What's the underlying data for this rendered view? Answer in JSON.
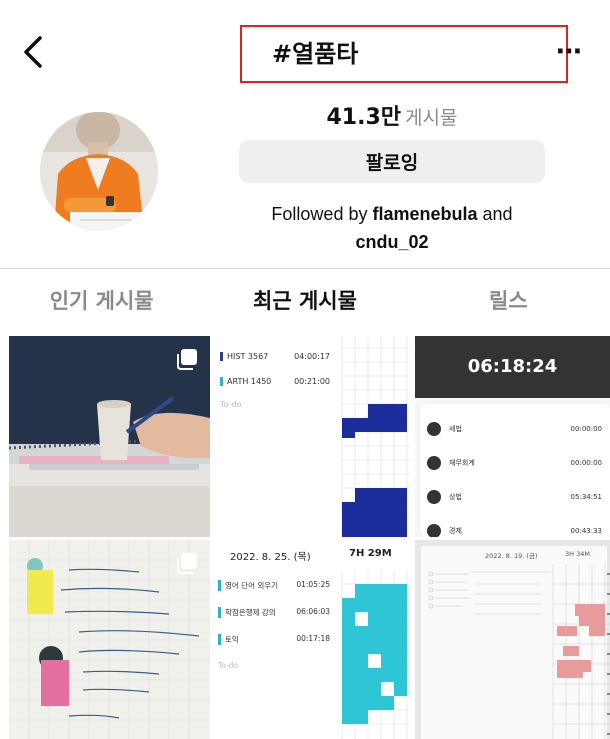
{
  "header": {
    "title": "#열품타"
  },
  "stats": {
    "count": "41.3만",
    "count_label": "게시물"
  },
  "follow_button": "팔로잉",
  "followed_by": {
    "prefix": "Followed by ",
    "user1": "flamenebula",
    "joiner": " and",
    "user2": "cndu_02"
  },
  "tabs": [
    "인기 게시물",
    "최근 게시물",
    "릴스"
  ],
  "posts": {
    "p2": {
      "items": [
        {
          "name": "HIST 3567",
          "time": "04:00:17"
        },
        {
          "name": "ARTH 1450",
          "time": "00:21:00"
        }
      ],
      "todo": "To-do"
    },
    "p3": {
      "timer": "06:18:24",
      "items": [
        {
          "name": "세법",
          "time": "00:00:00"
        },
        {
          "name": "재무회계",
          "time": "00:00:00"
        },
        {
          "name": "상법",
          "time": "05:34:51"
        },
        {
          "name": "경제",
          "time": "00:43:33"
        }
      ]
    },
    "p5": {
      "date": "2022. 8. 25. (목)",
      "total": "7H 29M",
      "items": [
        {
          "name": "영어 단어 외우기",
          "time": "01:05:25"
        },
        {
          "name": "학점은행제 강의",
          "time": "06:06:03"
        },
        {
          "name": "토익",
          "time": "00:17:18"
        }
      ],
      "todo": "To-do"
    },
    "p6": {
      "date": "2022. 8. 19. (금)",
      "total": "3H 34M"
    }
  }
}
